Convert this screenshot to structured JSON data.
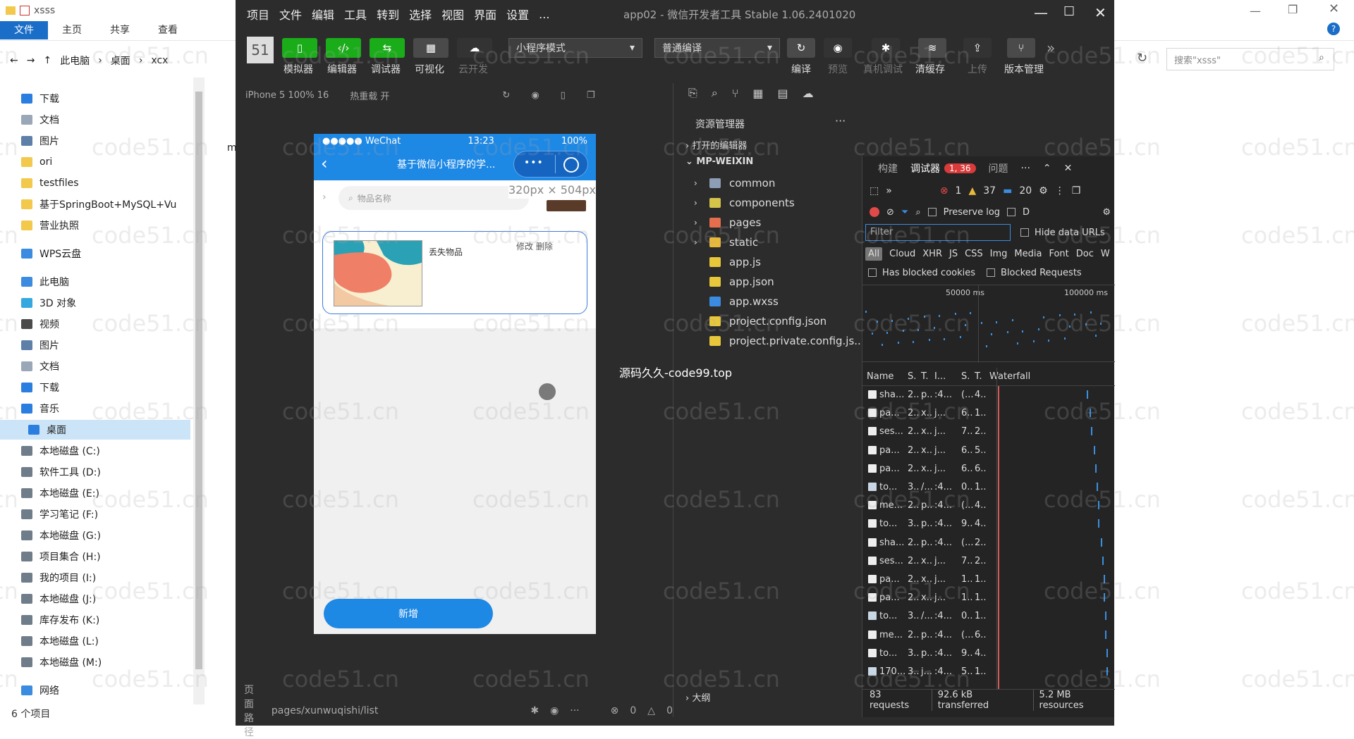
{
  "explorer": {
    "title": "xsss",
    "tabs": [
      "文件",
      "主页",
      "共享",
      "查看"
    ],
    "breadcrumb": [
      "此电脑",
      "桌面",
      "xcx"
    ],
    "search_placeholder": "搜索\"xsss\"",
    "nav_items": [
      {
        "label": "下载",
        "color": "#2a7ee0"
      },
      {
        "label": "文档",
        "color": "#9aa7b8"
      },
      {
        "label": "图片",
        "color": "#5d7fa8"
      },
      {
        "label": "ori",
        "color": "#f2c94c"
      },
      {
        "label": "testfiles",
        "color": "#f2c94c"
      },
      {
        "label": "基于SpringBoot+MySQL+Vu",
        "color": "#f2c94c"
      },
      {
        "label": "营业执照",
        "color": "#f2c94c"
      },
      {
        "label": "WPS云盘",
        "color": "#3b8ce0"
      },
      {
        "label": "此电脑",
        "color": "#3b8ce0"
      },
      {
        "label": "3D 对象",
        "color": "#35a8e0"
      },
      {
        "label": "视频",
        "color": "#4a4a4a"
      },
      {
        "label": "图片",
        "color": "#5d7fa8"
      },
      {
        "label": "文档",
        "color": "#9aa7b8"
      },
      {
        "label": "下载",
        "color": "#2a7ee0"
      },
      {
        "label": "音乐",
        "color": "#2a7ee0"
      },
      {
        "label": "桌面",
        "color": "#2a7ee0"
      },
      {
        "label": "本地磁盘 (C:)",
        "color": "#6f7d8a"
      },
      {
        "label": "软件工具 (D:)",
        "color": "#6f7d8a"
      },
      {
        "label": "本地磁盘 (E:)",
        "color": "#6f7d8a"
      },
      {
        "label": "学习笔记 (F:)",
        "color": "#6f7d8a"
      },
      {
        "label": "本地磁盘 (G:)",
        "color": "#6f7d8a"
      },
      {
        "label": "项目集合 (H:)",
        "color": "#6f7d8a"
      },
      {
        "label": "我的项目 (I:)",
        "color": "#6f7d8a"
      },
      {
        "label": "本地磁盘 (J:)",
        "color": "#6f7d8a"
      },
      {
        "label": "库存发布 (K:)",
        "color": "#6f7d8a"
      },
      {
        "label": "本地磁盘 (L:)",
        "color": "#6f7d8a"
      },
      {
        "label": "本地磁盘 (M:)",
        "color": "#6f7d8a"
      },
      {
        "label": "网络",
        "color": "#3b8ce0"
      }
    ],
    "selected_item": "桌面",
    "status": "6 个项目",
    "fragment_m": "m"
  },
  "devtools": {
    "menu": [
      "项目",
      "文件",
      "编辑",
      "工具",
      "转到",
      "选择",
      "视图",
      "界面",
      "设置",
      "..."
    ],
    "window_title": "app02 - 微信开发者工具 Stable 1.06.2401020",
    "toolbar": {
      "simulator": "模拟器",
      "editor": "编辑器",
      "debugger": "调试器",
      "visual": "可视化",
      "cloud": "云开发",
      "mode": "小程序模式",
      "compile_mode": "普通编译",
      "compile": "编译",
      "preview": "预览",
      "real_debug": "真机调试",
      "clear_cache": "清缓存",
      "upload": "上传",
      "version": "版本管理"
    },
    "sim_device": "iPhone 5 100% 16",
    "hot_reload": "热重载 开",
    "phone": {
      "status_left": "●●●●● WeChat",
      "time": "13:23",
      "battery": "100%",
      "nav_title": "基于微信小程序的学...",
      "search_placeholder": "物品名称",
      "size_tip": "320px × 504px",
      "card_title": "丢失物品",
      "card_actions": "修改 删除",
      "add_button": "新增"
    },
    "resource_manager": {
      "title": "资源管理器",
      "open_editors": "打开的编辑器",
      "project": "MP-WEIXIN",
      "items": [
        {
          "name": "common",
          "type": "folder",
          "color": "#8c9db5"
        },
        {
          "name": "components",
          "type": "folder",
          "color": "#d4c44a"
        },
        {
          "name": "pages",
          "type": "folder",
          "color": "#e56e4c"
        },
        {
          "name": "static",
          "type": "folder",
          "color": "#e8b83a"
        },
        {
          "name": "app.js",
          "type": "js",
          "color": "#e8c83a"
        },
        {
          "name": "app.json",
          "type": "json",
          "color": "#e8c83a"
        },
        {
          "name": "app.wxss",
          "type": "wxss",
          "color": "#3b8ce0"
        },
        {
          "name": "project.config.json",
          "type": "json",
          "color": "#e8c83a"
        },
        {
          "name": "project.private.config.js...",
          "type": "json",
          "color": "#e8c83a"
        }
      ],
      "outline": "大纲"
    },
    "debug_tabs": {
      "build": "构建",
      "debugger": "调试器",
      "badge": "1, 36",
      "issues": "问题"
    },
    "console_counts": {
      "errors": "1",
      "warnings": "37",
      "info": "20"
    },
    "filters": {
      "preserve_log": "Preserve log",
      "disable": "D",
      "filter_placeholder": "Filter",
      "hide_data_urls": "Hide data URLs",
      "types": [
        "All",
        "Cloud",
        "XHR",
        "JS",
        "CSS",
        "Img",
        "Media",
        "Font",
        "Doc",
        "W"
      ],
      "blocked_cookies": "Has blocked cookies",
      "blocked_requests": "Blocked Requests",
      "tick1": "50000 ms",
      "tick2": "100000 ms"
    },
    "network": {
      "headers": [
        "Name",
        "S.",
        "T.",
        "I...",
        "S.",
        "T.",
        "Waterfall"
      ],
      "rows": [
        [
          "sha...",
          "2..",
          "p..",
          ":4...",
          "(...",
          "4..",
          "sq"
        ],
        [
          "pa...",
          "2..",
          "x..",
          "j...",
          "6..",
          "1..",
          "sq"
        ],
        [
          "ses...",
          "2..",
          "x..",
          "j...",
          "7..",
          "2..",
          "sq"
        ],
        [
          "pa...",
          "2..",
          "x..",
          "j...",
          "6..",
          "5..",
          "sq"
        ],
        [
          "pa...",
          "2..",
          "x..",
          "j...",
          "6..",
          "6..",
          "sq"
        ],
        [
          "to...",
          "3..",
          "/...",
          ":4...",
          "0..",
          "1..",
          "img"
        ],
        [
          "me...",
          "2..",
          "p..",
          ":4...",
          "(...",
          "4..",
          "sq"
        ],
        [
          "to...",
          "3..",
          "p..",
          ":4...",
          "9..",
          "4..",
          "sq"
        ],
        [
          "sha...",
          "2..",
          "p..",
          ":4...",
          "(...",
          "2..",
          "sq"
        ],
        [
          "ses...",
          "2..",
          "x..",
          "j...",
          "7..",
          "2..",
          "sq"
        ],
        [
          "pa...",
          "2..",
          "x..",
          "j...",
          "1..",
          "1..",
          "sq"
        ],
        [
          "pa...",
          "2..",
          "x..",
          "j...",
          "1..",
          "1..",
          "sq"
        ],
        [
          "to...",
          "3..",
          "/...",
          ":4...",
          "0..",
          "1..",
          "img"
        ],
        [
          "me...",
          "2..",
          "p..",
          ":4...",
          "(...",
          "6..",
          "sq"
        ],
        [
          "to...",
          "3..",
          "p..",
          ":4...",
          "9..",
          "4..",
          "sq"
        ],
        [
          "170...",
          "3..",
          "j...",
          ":4...",
          "5..",
          "1..",
          "img"
        ]
      ],
      "summary": [
        "83 requests",
        "92.6 kB transferred",
        "5.2 MB resources"
      ]
    },
    "bottom": {
      "path_label": "页面路径",
      "path": "pages/xunwuqishi/list",
      "errors": "0",
      "warnings": "0"
    }
  },
  "watermarks": {
    "site": "code51.cn",
    "center": "源码久久-code99.top"
  }
}
